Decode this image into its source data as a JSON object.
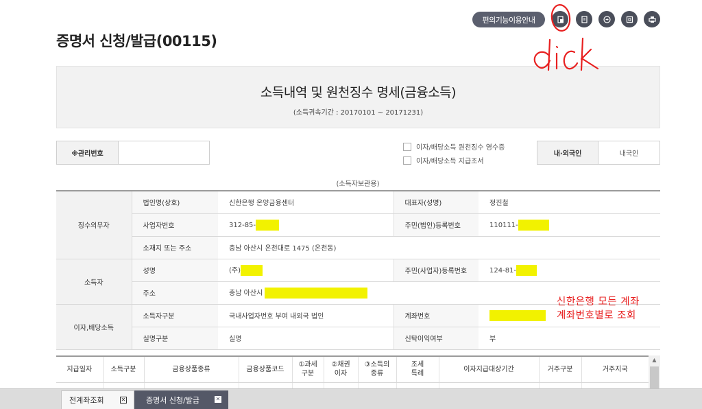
{
  "toolbar": {
    "guide_label": "편의기능이용안내",
    "icons": [
      "document-icon",
      "list-icon",
      "zoom-in-icon",
      "window-icon",
      "print-icon"
    ]
  },
  "page_title": "증명서 신청/발급(00115)",
  "annotation": {
    "click_text": "click",
    "note_line1": "신한은행 모든 계좌",
    "note_line2": "계좌번호별로 조회",
    "color": "#e82020"
  },
  "doc": {
    "title": "소득내역 및 원천징수 명세(금융소득)",
    "period": "(소득귀속기간 :  20170101 ~ 20171231)"
  },
  "mgmt": {
    "label": "※관리번호",
    "value": ""
  },
  "checkboxes": [
    {
      "label": "이자/배당소득 원천징수 영수증"
    },
    {
      "label": "이자/배당소득 지급조서"
    }
  ],
  "nationality": {
    "label": "내·외국인",
    "value": "내국인"
  },
  "keep_label": "(소득자보관용)",
  "withholder": {
    "section": "징수의무자",
    "corp_name_label": "법인명(상호)",
    "corp_name": "신한은행 온양금융센터",
    "rep_label": "대표자(성명)",
    "rep": "정진철",
    "biz_no_label": "사업자번호",
    "biz_no": "312-85-",
    "reg_no_label": "주민(법인)등록번호",
    "reg_no": "110111-",
    "address_label": "소재지 또는 주소",
    "address": "충남 아산시 온천대로 1475 (온천동)"
  },
  "earner": {
    "section": "소득자",
    "name_label": "성명",
    "name": "(주)",
    "reg_no_label": "주민(사업자)등록번호",
    "reg_no": "124-81-",
    "address_label": "주소",
    "address": "충남 아산시"
  },
  "interest": {
    "section": "이자,배당소득",
    "type_label": "소득자구분",
    "type": "국내사업자번호 부여 내외국 법인",
    "account_label": "계좌번호",
    "account": "",
    "realname_label": "실명구분",
    "realname": "실명",
    "trust_label": "신탁이익여부",
    "trust": "부"
  },
  "grid": {
    "headers": [
      [
        "지급일자"
      ],
      [
        "소득구분"
      ],
      [
        "금융상품종류"
      ],
      [
        "금융상품코드"
      ],
      [
        "①과세",
        "구분"
      ],
      [
        "②채권",
        "이자"
      ],
      [
        "③소득의",
        "종류"
      ],
      [
        "조세",
        "특례"
      ],
      [
        "이자지급대상기간"
      ],
      [
        "거주구분"
      ],
      [
        "거주지국"
      ]
    ]
  },
  "tabs": [
    {
      "label": "전계좌조회",
      "active": false
    },
    {
      "label": "증명서 신청/발급",
      "active": true
    }
  ]
}
